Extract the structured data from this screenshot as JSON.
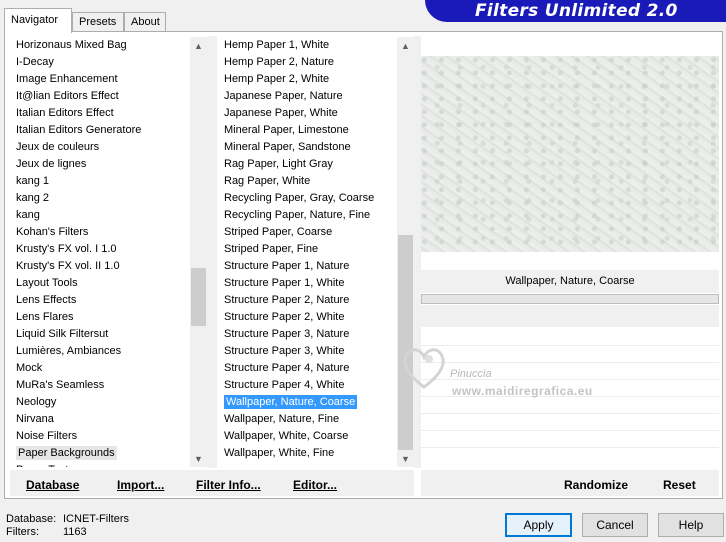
{
  "tabs": [
    {
      "label": "Navigator",
      "active": true
    },
    {
      "label": "Presets",
      "active": false
    },
    {
      "label": "About",
      "active": false
    }
  ],
  "banner": {
    "title": "Filters Unlimited 2.0",
    "color": "#1a1ab8"
  },
  "categories": {
    "items": [
      "Horizonaus Mixed Bag",
      "I-Decay",
      "Image Enhancement",
      "It@lian Editors Effect",
      "Italian Editors Effect",
      "Italian Editors Generatore",
      "Jeux de couleurs",
      "Jeux de lignes",
      "kang 1",
      "kang 2",
      "kang",
      "Kohan's Filters",
      "Krusty's FX vol. I 1.0",
      "Krusty's FX vol. II 1.0",
      "Layout Tools",
      "Lens Effects",
      "Lens Flares",
      "Liquid Silk Filtersut",
      "Lumières, Ambiances",
      "Mock",
      "MuRa's Seamless",
      "Neology",
      "Nirvana",
      "Noise Filters",
      "Paper Backgrounds",
      "Paper Textures"
    ],
    "selected_index": 24
  },
  "filters": {
    "items": [
      "Hemp Paper 1, White",
      "Hemp Paper 2, Nature",
      "Hemp Paper 2, White",
      "Japanese Paper, Nature",
      "Japanese Paper, White",
      "Mineral Paper, Limestone",
      "Mineral Paper, Sandstone",
      "Rag Paper, Light Gray",
      "Rag Paper, White",
      "Recycling Paper, Gray, Coarse",
      "Recycling Paper, Nature, Fine",
      "Striped Paper, Coarse",
      "Striped Paper, Fine",
      "Structure Paper 1, Nature",
      "Structure Paper 1, White",
      "Structure Paper 2, Nature",
      "Structure Paper 2, White",
      "Structure Paper 3, Nature",
      "Structure Paper 3, White",
      "Structure Paper 4, Nature",
      "Structure Paper 4, White",
      "Wallpaper, Nature, Coarse",
      "Wallpaper, Nature, Fine",
      "Wallpaper, White, Coarse",
      "Wallpaper, White, Fine"
    ],
    "selected_index": 21
  },
  "preview": {
    "filter_name": "Wallpaper, Nature, Coarse"
  },
  "watermark": {
    "line1": "Pinuccia",
    "line2": "www.maidiregrafica.eu"
  },
  "bar_buttons": {
    "database": "Database",
    "import": "Import...",
    "filter_info": "Filter Info...",
    "editor": "Editor...",
    "randomize": "Randomize",
    "reset": "Reset"
  },
  "status": {
    "database_label": "Database:",
    "database_value": "ICNET-Filters",
    "filters_label": "Filters:",
    "filters_value": "1163"
  },
  "dialog_buttons": {
    "apply": "Apply",
    "cancel": "Cancel",
    "help": "Help"
  },
  "colors": {
    "selection": "#3399ff",
    "accent": "#0078d7"
  }
}
